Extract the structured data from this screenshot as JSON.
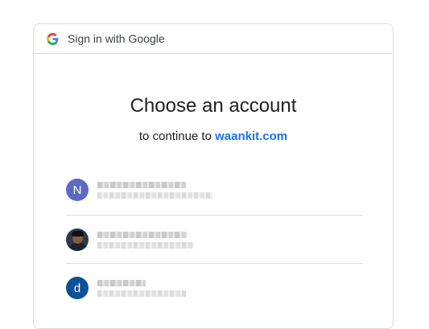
{
  "header": {
    "title": "Sign in with Google",
    "logo_icon": "google-g-icon"
  },
  "main": {
    "title": "Choose an account",
    "subtitle_prefix": "to continue to",
    "site_link": "waankit.com"
  },
  "colors": {
    "link": "#1a73e8",
    "border": "#dadce0",
    "avatar_n": "#5c6bc0",
    "avatar_d": "#0d5295"
  },
  "accounts": [
    {
      "avatar_letter": "N"
    },
    {
      "avatar_letter": ""
    },
    {
      "avatar_letter": "d"
    }
  ]
}
